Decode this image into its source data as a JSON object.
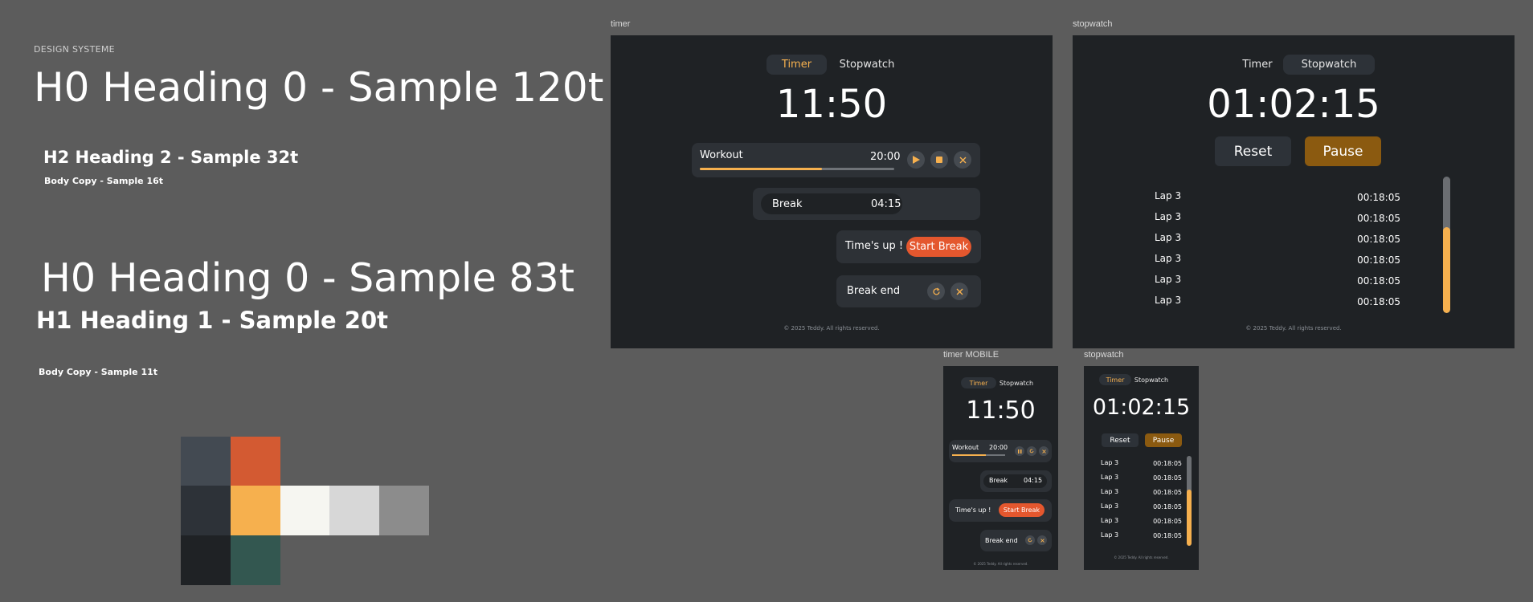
{
  "design_system": {
    "title": "DESIGN SYSTEME",
    "h0_120": "H0 Heading 0 - Sample 120t",
    "h2_32": "H2 Heading 2 - Sample 32t",
    "body_16": "Body Copy - Sample 16t",
    "h0_83": "H0 Heading 0 - Sample 83t",
    "h1_20": "H1 Heading 1 - Sample 20t",
    "body_11": "Body Copy - Sample 11t",
    "palette": [
      "#434a52",
      "#d35a32",
      "#2d3238",
      "#f6b04e",
      "#f6f6f1",
      "#d7d7d7",
      "#8c8c8c",
      "#1f2225",
      "#335750"
    ]
  },
  "frames": {
    "timer_label": "timer",
    "stopwatch_label": "stopwatch",
    "timer_mobile_label": "timer MOBILE",
    "stopwatch_mobile_label": "stopwatch"
  },
  "timer": {
    "tab_timer": "Timer",
    "tab_stopwatch": "Stopwatch",
    "time": "11:50",
    "workout_label": "Workout",
    "workout_time": "20:00",
    "workout_progress": 0.63,
    "break_label": "Break",
    "break_time": "04:15",
    "times_up": "Time's up !",
    "start_break": "Start Break",
    "break_end": "Break end",
    "footer": "© 2025 Teddy. All rights reserved."
  },
  "stopwatch": {
    "tab_timer": "Timer",
    "tab_stopwatch": "Stopwatch",
    "time": "01:02:15",
    "reset": "Reset",
    "pause": "Pause",
    "laps": [
      {
        "name": "Lap 3",
        "time": "00:18:05"
      },
      {
        "name": "Lap 3",
        "time": "00:18:05"
      },
      {
        "name": "Lap 3",
        "time": "00:18:05"
      },
      {
        "name": "Lap 3",
        "time": "00:18:05"
      },
      {
        "name": "Lap 3",
        "time": "00:18:05"
      },
      {
        "name": "Lap 3",
        "time": "00:18:05"
      }
    ],
    "footer": "© 2025 Teddy. All rights reserved."
  },
  "colors": {
    "accent_orange": "#f6b04e",
    "accent_red": "#e4572e",
    "pause_brown": "#8b5a10",
    "background": "#1f2225"
  }
}
